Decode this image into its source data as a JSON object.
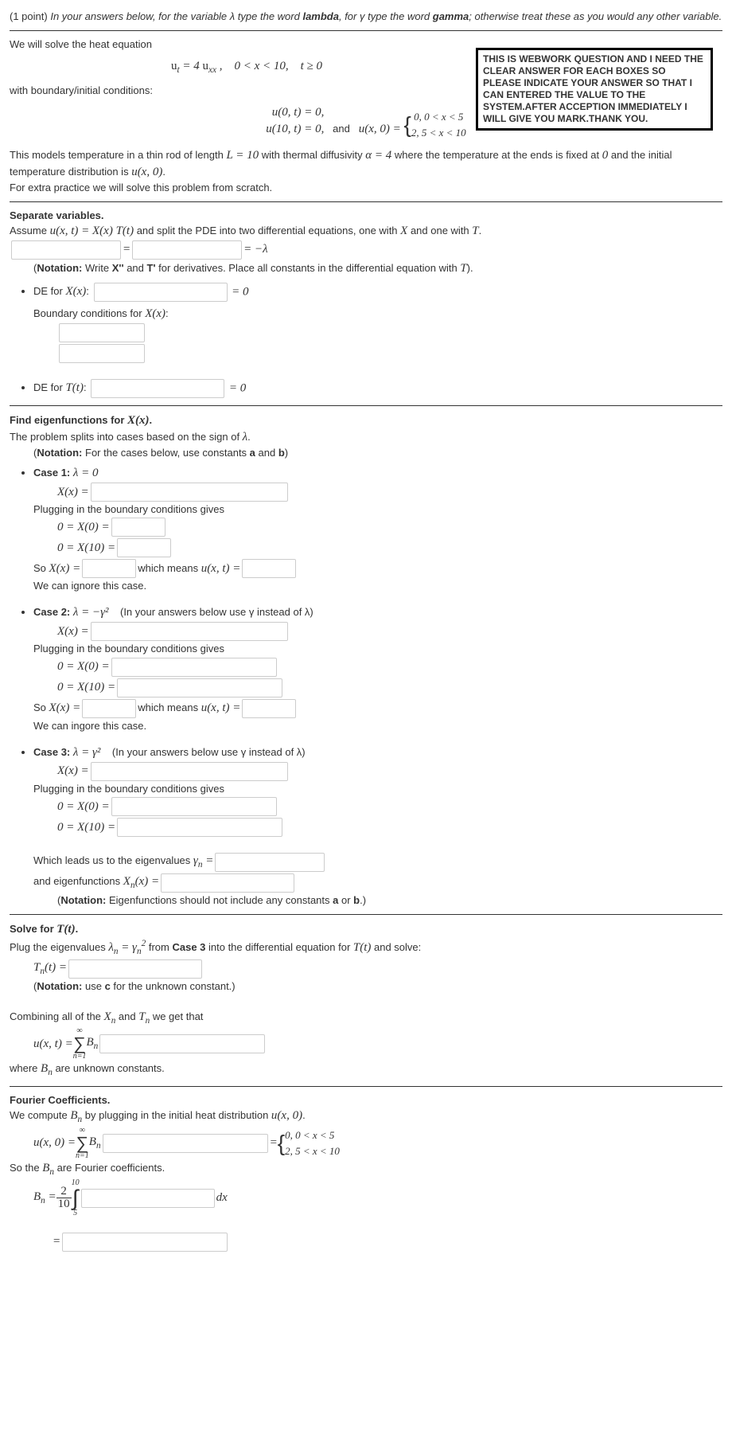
{
  "header": {
    "points": "(1 point)",
    "intro": "In your answers below, for the variable λ type the word ",
    "word1": "lambda",
    "intro2": ", for γ type the word ",
    "word2": "gamma",
    "intro3": "; otherwise treat these as you would any other variable."
  },
  "notebox": "THIS IS WEBWORK QUESTION AND I NEED THE CLEAR ANSWER FOR EACH BOXES SO PLEASE INDICATE YOUR ANSWER SO THAT I CAN ENTERED THE VALUE TO THE SYSTEM.AFTER ACCEPTION IMMEDIATELY I WILL GIVE YOU MARK.THANK YOU.",
  "heat": {
    "lead": "We will solve the heat equation",
    "eq": "uₜ = 4 uₓₓ ,    0 < x < 10,    t ≥ 0",
    "bc_lead": "with boundary/initial conditions:",
    "bc_left1": "u(0, t) = 0,",
    "bc_left2": "u(10, t) = 0,",
    "and": "and",
    "ic_lhs": "u(x, 0) = ",
    "ic_case1": "0,   0 < x < 5",
    "ic_case2": "2,   5 < x < 10",
    "desc1": "This models temperature in a thin rod of length ",
    "desc_L": "L = 10",
    "desc2": " with thermal diffusivity ",
    "desc_a": "α = 4",
    "desc3": " where the temperature at the ends is fixed at ",
    "zero": "0",
    "desc4": " and the initial temperature distribution is ",
    "ux0": "u(x, 0)",
    "dot": ".",
    "extra": "For extra practice we will solve this problem from scratch."
  },
  "sep": {
    "title": "Separate variables.",
    "assume1": "Assume ",
    "assume_eq": "u(x, t) = X(x) T(t)",
    "assume2": " and split the PDE into two differential equations, one with ",
    "X": "X",
    "assume3": " and one with ",
    "T": "T",
    "eqmid": " = ",
    "eqrhs": " = −λ",
    "note": "(Notation: Write X'' and T' for derivatives. Place all constants in the differential equation with T).",
    "de_x": "DE for X(x):",
    "eq0": " = 0",
    "bc_x": "Boundary conditions for X(x):",
    "de_t": "DE for T(t):"
  },
  "eigen": {
    "title": "Find eigenfunctions for X(x).",
    "lead": "The problem splits into cases based on the sign of λ.",
    "note": "(Notation: For the cases below, use constants a and b)",
    "c1_title": "Case 1: λ = 0",
    "Xx": "X(x) = ",
    "plug": "Plugging in the boundary conditions gives",
    "r1": "0 = X(0) = ",
    "r2": "0 = X(10) = ",
    "soXx": "So X(x) = ",
    "means": " which means u(x, t) = ",
    "ignore": "We can ignore this case.",
    "c2_title": "Case 2: λ = −γ²",
    "c2_hint": "(In your answers below use γ instead of λ)",
    "ingore2": "We can ingore this case.",
    "c3_title": "Case 3: λ = γ²",
    "c3_hint": "(In your answers below use γ instead of λ)",
    "leads": "Which leads us to the eigenvalues γₙ = ",
    "eigfn": "and eigenfunctions Xₙ(x) = ",
    "note2": "(Notation: Eigenfunctions should not include any constants a or b.)"
  },
  "solveT": {
    "title": "Solve for T(t).",
    "lead1": "Plug the eigenvalues ",
    "lam": "λₙ = γₙ²",
    "lead2": " from ",
    "case3": "Case 3",
    "lead3": " into the differential equation for ",
    "Tt": "T(t)",
    "lead4": " and solve:",
    "Tnt": "Tₙ(t) = ",
    "note": "(Notation: use c for the unknown constant.)",
    "comb": "Combining all of the Xₙ and Tₙ we get that",
    "lhs": "u(x, t) = ",
    "sum_top": "∞",
    "sum_bot": "n=1",
    "Bn": " Bₙ ",
    "where": "where Bₙ are unknown constants."
  },
  "fourier": {
    "title": "Fourier Coefficients.",
    "lead": "We compute Bₙ by plugging in the initial heat distribution u(x, 0).",
    "lhs": "u(x, 0) = ",
    "eq": " = ",
    "case1": "0,   0 < x < 5",
    "case2": "2,   5 < x < 10",
    "so": "So the Bₙ are Fourier coefficients.",
    "Bnlhs": "Bₙ = ",
    "frac_num": "2",
    "frac_den": "10",
    "int_top": "10",
    "int_bot": "5",
    "dx": " dx",
    "eq2": "= "
  }
}
